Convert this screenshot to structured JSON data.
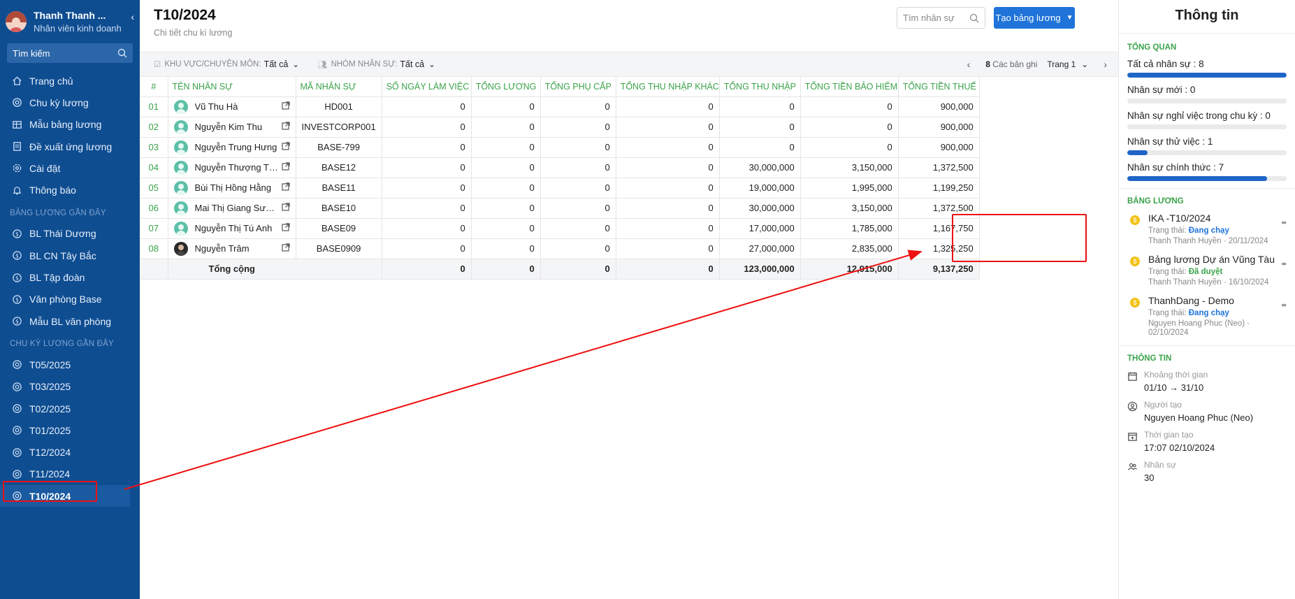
{
  "sidebar": {
    "user_name": "Thanh Thanh ...",
    "user_role": "Nhân viên kinh doanh",
    "search_label": "Tìm kiếm",
    "menu": [
      {
        "label": "Trang chủ",
        "icon": "home-icon"
      },
      {
        "label": "Chu kỳ lương",
        "icon": "cycle-icon"
      },
      {
        "label": "Mẫu bảng lương",
        "icon": "table-icon"
      },
      {
        "label": "Đề xuất ứng lương",
        "icon": "document-icon"
      },
      {
        "label": "Cài đặt",
        "icon": "gear-icon"
      },
      {
        "label": "Thông báo",
        "icon": "bell-icon"
      }
    ],
    "recent_payrolls_title": "BẢNG LƯƠNG GẦN ĐÂY",
    "recent_payrolls": [
      "BL Thái Dương",
      "BL CN Tây Bắc",
      "BL Tập đoàn",
      "Văn phòng Base",
      "Mẫu BL văn phòng"
    ],
    "recent_cycles_title": "CHU KỲ LƯƠNG GẦN ĐÂY",
    "recent_cycles": [
      "T05/2025",
      "T03/2025",
      "T02/2025",
      "T01/2025",
      "T12/2024",
      "T11/2024",
      "T10/2024"
    ]
  },
  "header": {
    "title": "T10/2024",
    "subtitle": "Chi tiết chu kì lương",
    "search_placeholder": "Tìm nhân sự",
    "create_button": "Tạo bảng lương"
  },
  "filters": {
    "area_label": "KHU VỰC/CHUYÊN MÔN:",
    "area_value": "Tất cả",
    "group_label": "NHÓM NHÂN SỰ:",
    "group_value": "Tất cả",
    "record_count": "8",
    "record_label": "Các bản ghi",
    "page_label": "Trang 1"
  },
  "table": {
    "columns": [
      "#",
      "TÊN NHÂN SỰ",
      "MÃ NHÂN SỰ",
      "SỐ NGÀY LÀM VIỆC",
      "TỔNG LƯƠNG",
      "TỔNG PHỤ CẤP",
      "TỔNG THU NHẬP KHÁC",
      "TỔNG THU NHẬP",
      "TỔNG TIỀN BẢO HIỂM",
      "TỔNG TIỀN THUẾ"
    ],
    "rows": [
      {
        "idx": "01",
        "name": "Vũ Thu Hà",
        "code": "HD001",
        "days": "0",
        "salary": "0",
        "allowance": "0",
        "other": "0",
        "income": "0",
        "insurance": "0",
        "tax": "900,000"
      },
      {
        "idx": "02",
        "name": "Nguyễn Kim Thu",
        "code": "INVESTCORP001",
        "days": "0",
        "salary": "0",
        "allowance": "0",
        "other": "0",
        "income": "0",
        "insurance": "0",
        "tax": "900,000"
      },
      {
        "idx": "03",
        "name": "Nguyễn Trung Hưng",
        "code": "BASE-799",
        "days": "0",
        "salary": "0",
        "allowance": "0",
        "other": "0",
        "income": "0",
        "insurance": "0",
        "tax": "900,000"
      },
      {
        "idx": "04",
        "name": "Nguyễn Thượng Tường",
        "code": "BASE12",
        "days": "0",
        "salary": "0",
        "allowance": "0",
        "other": "0",
        "income": "30,000,000",
        "insurance": "3,150,000",
        "tax": "1,372,500"
      },
      {
        "idx": "05",
        "name": "Bùi Thị Hồng Hằng",
        "code": "BASE11",
        "days": "0",
        "salary": "0",
        "allowance": "0",
        "other": "0",
        "income": "19,000,000",
        "insurance": "1,995,000",
        "tax": "1,199,250"
      },
      {
        "idx": "06",
        "name": "Mai Thị Giang Sương",
        "code": "BASE10",
        "days": "0",
        "salary": "0",
        "allowance": "0",
        "other": "0",
        "income": "30,000,000",
        "insurance": "3,150,000",
        "tax": "1,372,500"
      },
      {
        "idx": "07",
        "name": "Nguyễn Thị Tú Anh",
        "code": "BASE09",
        "days": "0",
        "salary": "0",
        "allowance": "0",
        "other": "0",
        "income": "17,000,000",
        "insurance": "1,785,000",
        "tax": "1,167,750"
      },
      {
        "idx": "08",
        "name": "Nguyễn Trâm",
        "code": "BASE0909",
        "days": "0",
        "salary": "0",
        "allowance": "0",
        "other": "0",
        "income": "27,000,000",
        "insurance": "2,835,000",
        "tax": "1,325,250"
      }
    ],
    "total": {
      "label": "Tổng cộng",
      "days": "0",
      "salary": "0",
      "allowance": "0",
      "other": "0",
      "income": "123,000,000",
      "insurance": "12,915,000",
      "tax": "9,137,250"
    }
  },
  "right_panel": {
    "title": "Thông tin",
    "overview_title": "TỔNG QUAN",
    "stats": [
      {
        "label": "Tất cả nhân sự : 8",
        "fraction": 1.0
      },
      {
        "label": "Nhân sự mới : 0",
        "fraction": 0.0
      },
      {
        "label": "Nhân sự nghỉ việc trong chu kỳ : 0",
        "fraction": 0.0
      },
      {
        "label": "Nhân sự thử việc : 1",
        "fraction": 0.125
      },
      {
        "label": "Nhân sự chính thức : 7",
        "fraction": 0.875
      }
    ],
    "payroll_title": "BẢNG LƯƠNG",
    "status_label": "Trạng thái:",
    "payrolls": [
      {
        "name": "IKA -T10/2024",
        "status": "Đang chạy",
        "meta": "Thanh Thanh Huyền · 20/11/2024"
      },
      {
        "name": "Bảng lương Dự án Vũng Tàu",
        "status": "Đã duyệt",
        "meta": "Thanh Thanh Huyền · 16/10/2024"
      },
      {
        "name": "ThanhDang - Demo",
        "status": "Đang chạy",
        "meta": "Nguyen Hoang Phuc (Neo) ·",
        "meta2": "02/10/2024"
      }
    ],
    "info_title": "THÔNG TIN",
    "info": [
      {
        "label": "Khoảng thời gian",
        "value": "01/10 → 31/10",
        "icon": "calendar-icon"
      },
      {
        "label": "Người tạo",
        "value": "Nguyen Hoang Phuc (Neo)",
        "icon": "user-icon"
      },
      {
        "label": "Thời gian tạo",
        "value": "17:07 02/10/2024",
        "icon": "calendar-plus-icon"
      },
      {
        "label": "Nhân sự",
        "value": "30",
        "icon": "users-icon"
      }
    ]
  },
  "colors": {
    "sidebar_bg": "#0f4d91",
    "accent_blue": "#1f73d9",
    "header_green": "#3aa34a",
    "annotation_red": "#e11111"
  }
}
